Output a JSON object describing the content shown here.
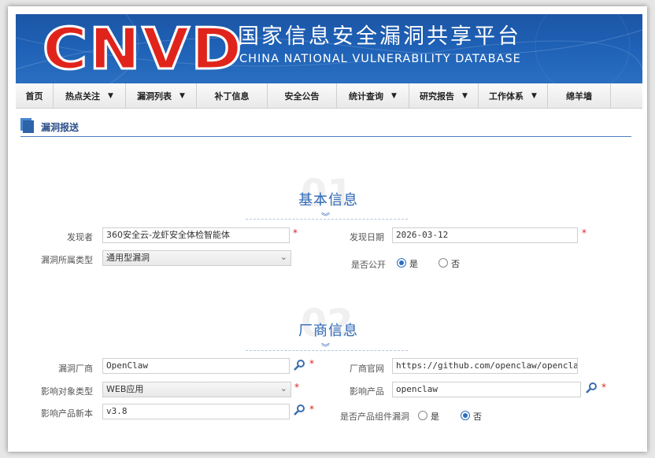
{
  "banner": {
    "logo": "CNVD",
    "title_cn": "国家信息安全漏洞共享平台",
    "title_en": "CHINA NATIONAL VULNERABILITY DATABASE"
  },
  "nav": [
    {
      "label": "首页",
      "dropdown": false
    },
    {
      "label": "热点关注",
      "dropdown": true
    },
    {
      "label": "漏洞列表",
      "dropdown": true
    },
    {
      "label": "补丁信息",
      "dropdown": false
    },
    {
      "label": "安全公告",
      "dropdown": false
    },
    {
      "label": "统计查询",
      "dropdown": true
    },
    {
      "label": "研究报告",
      "dropdown": true
    },
    {
      "label": "工作体系",
      "dropdown": true
    },
    {
      "label": "绵羊墙",
      "dropdown": false
    }
  ],
  "section": {
    "title": "漏洞报送"
  },
  "basic": {
    "num": "01",
    "title": "基本信息",
    "discoverer_label": "发现者",
    "discoverer_value": "360安全云-龙虾安全体检智能体",
    "date_label": "发现日期",
    "date_value": "2026-03-12",
    "vuln_type_label": "漏洞所属类型",
    "vuln_type_value": "通用型漏洞",
    "public_label": "是否公开",
    "yes": "是",
    "no": "否",
    "public_selected": "yes"
  },
  "vendor": {
    "num": "02",
    "title": "厂商信息",
    "vendor_label": "漏洞厂商",
    "vendor_value": "OpenClaw",
    "site_label": "厂商官网",
    "site_value": "https://github.com/openclaw/openclaw",
    "target_type_label": "影响对象类型",
    "target_type_value": "WEB应用",
    "product_label": "影响产品",
    "product_value": "openclaw",
    "version_label": "影响产品新本",
    "version_value": "v3.8",
    "component_label": "是否产品组件漏洞",
    "yes": "是",
    "no": "否",
    "component_selected": "no"
  },
  "required_mark": "*",
  "colors": {
    "banner": "#1f62b7",
    "logo_red": "#e0241b",
    "accent": "#2f6ab8",
    "required": "#e02020"
  }
}
